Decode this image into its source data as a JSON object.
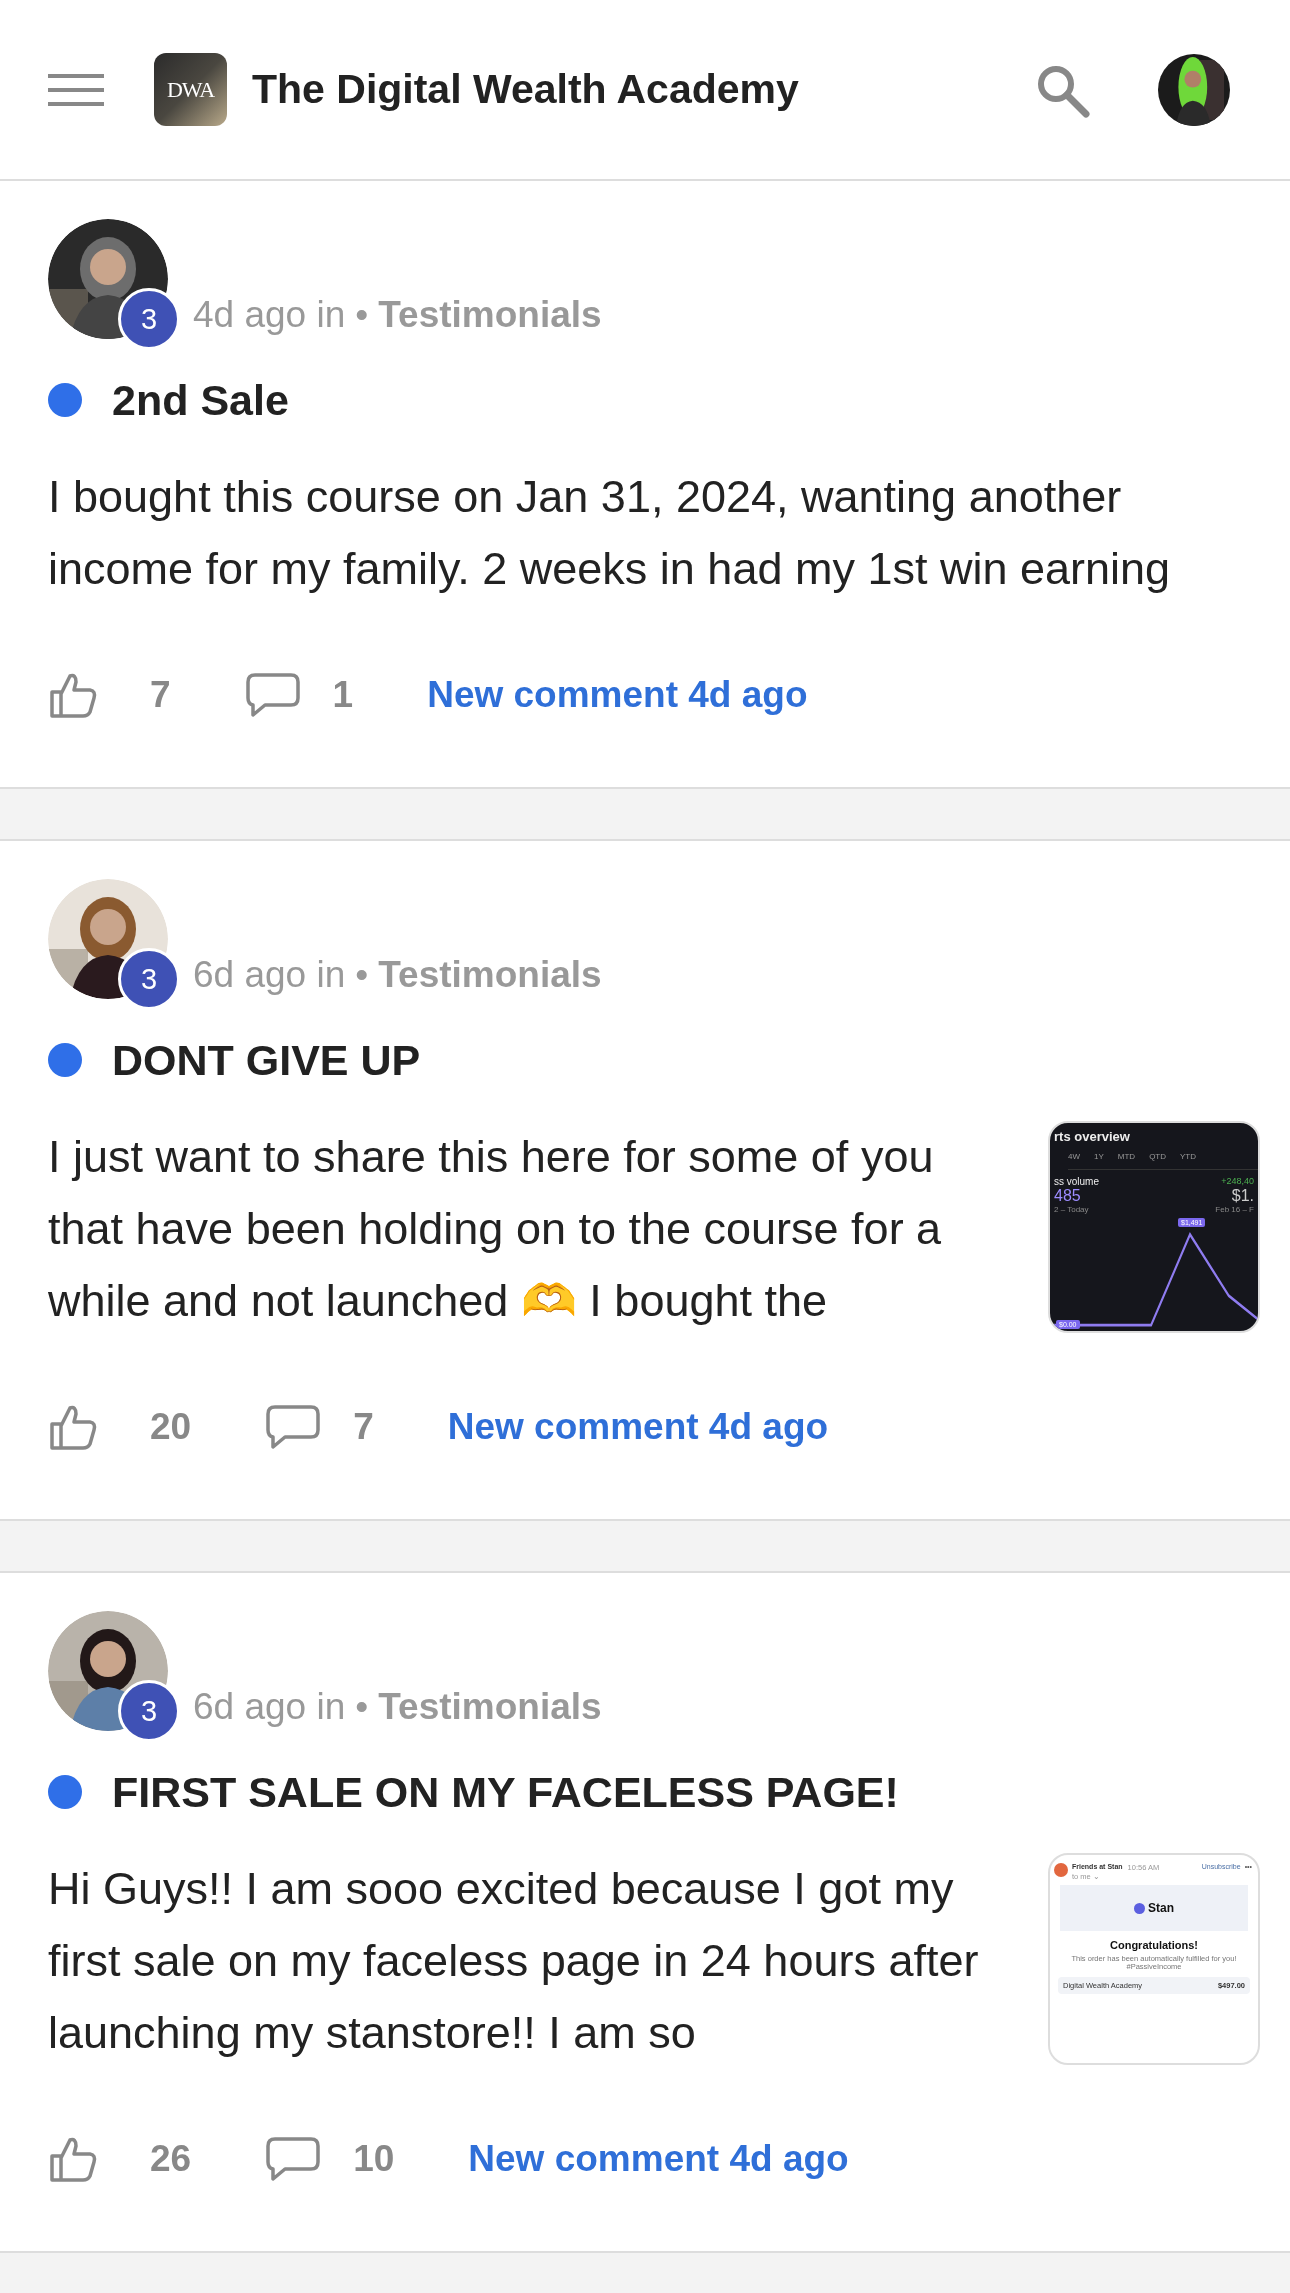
{
  "header": {
    "logo_text": "DWA",
    "title": "The Digital Wealth Academy"
  },
  "posts": [
    {
      "level": "3",
      "time": "4d ago in",
      "separator": "•",
      "category": "Testimonials",
      "unread": true,
      "title": "2nd Sale",
      "body": "I bought this course on Jan 31, 2024, wanting another income for my family. 2 weeks in had my 1st win earning",
      "likes": "7",
      "comments": "1",
      "activity": "New comment 4d ago"
    },
    {
      "level": "3",
      "time": "6d ago in",
      "separator": "•",
      "category": "Testimonials",
      "unread": true,
      "title": "DONT GIVE UP",
      "body": "I just want to share this here for some of you that have been holding on to the course for a while and not launched 🫶 I bought the",
      "likes": "20",
      "comments": "7",
      "activity": "New comment 4d ago",
      "thumbnail": {
        "kind": "stats",
        "title": "rts overview",
        "tabs": [
          "4W",
          "1Y",
          "MTD",
          "QTD",
          "YTD"
        ],
        "metric": "ss volume",
        "change": "+248,40",
        "value": "485",
        "value_2": "$1.",
        "range": "2 – Today",
        "range_2": "Feb 16 – F",
        "peak": "$1,491",
        "base": "$0.00"
      }
    },
    {
      "level": "3",
      "time": "6d ago in",
      "separator": "•",
      "category": "Testimonials",
      "unread": true,
      "title": "FIRST SALE ON MY FACELESS PAGE!",
      "body": "Hi Guys!! I am sooo excited because I got my first sale on my faceless page in 24 hours after launching my stanstore!! I am so",
      "likes": "26",
      "comments": "10",
      "activity": "New comment 4d ago",
      "thumbnail": {
        "kind": "email",
        "sender": "Friends at Stan",
        "time": "10:56 AM",
        "to": "to me ⌄",
        "action": "Unsubscribe",
        "more": "•••",
        "brand": "Stan",
        "heading": "Congratulations!",
        "message": "This order has been automatically fulfilled for you! #PassiveIncome",
        "item": "Digital Wealth Academy",
        "price": "$497.00"
      }
    }
  ]
}
